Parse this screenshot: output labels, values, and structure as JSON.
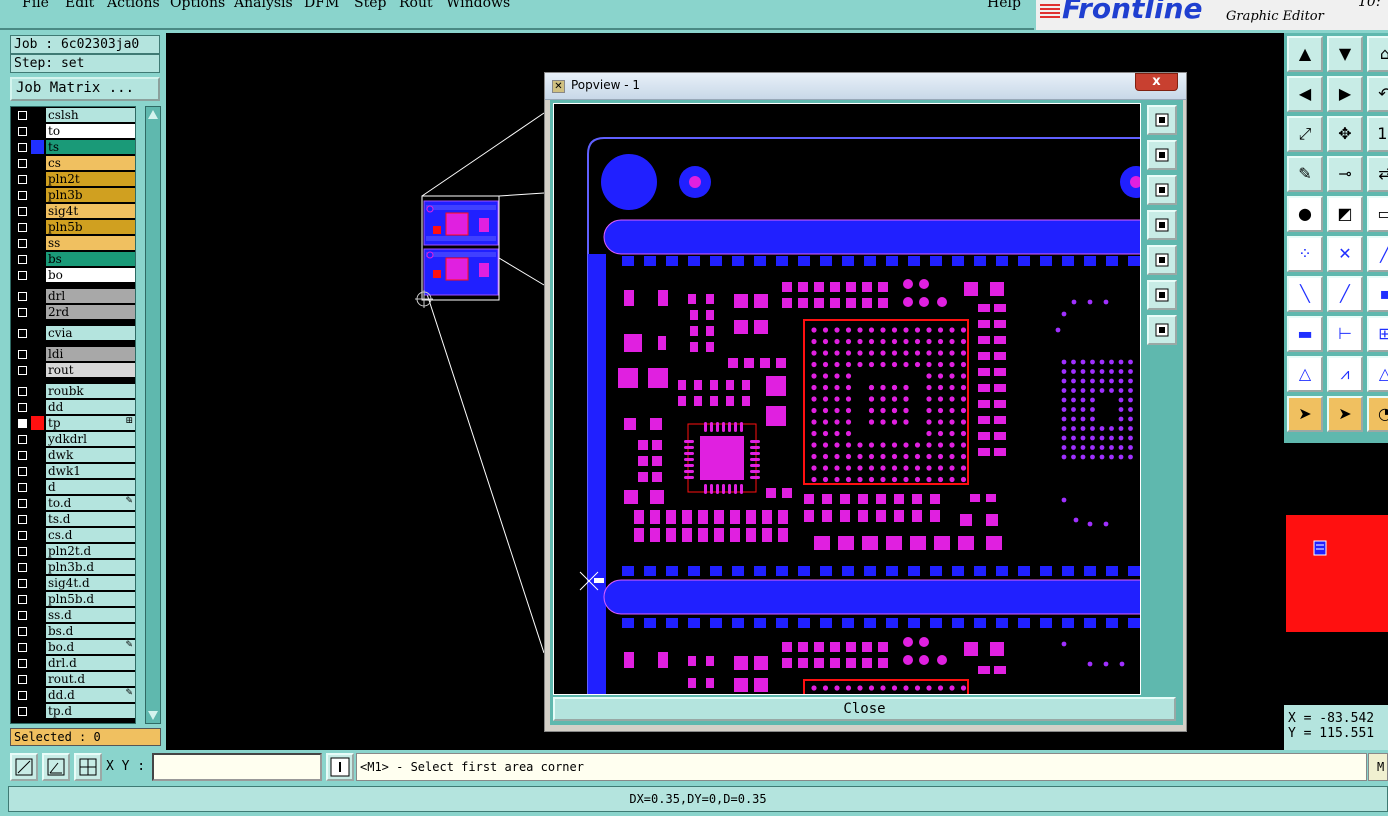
{
  "menu": {
    "items": [
      {
        "label": "File",
        "key": "F"
      },
      {
        "label": "Edit",
        "key": "E"
      },
      {
        "label": "Actions",
        "key": "A"
      },
      {
        "label": "Options",
        "key": "O"
      },
      {
        "label": "Analysis",
        "key": "A"
      },
      {
        "label": "DFM",
        "key": "D"
      },
      {
        "label": "Step",
        "key": "S"
      },
      {
        "label": "Rout",
        "key": "R"
      },
      {
        "label": "Windows",
        "key": "W"
      }
    ],
    "help": "Help"
  },
  "brand": {
    "logo": "Frontline",
    "subtitle": "Graphic Editor",
    "time": "10:"
  },
  "job": {
    "job_label": "Job : 6c02303ja0",
    "step_label": "Step: set",
    "matrix_button": "Job Matrix ..."
  },
  "layers": [
    {
      "name": "cslsh",
      "bg": "#b4e4de",
      "swatch": "#000",
      "group": 1
    },
    {
      "name": "to",
      "bg": "#ffffff",
      "swatch": "#000",
      "group": 1
    },
    {
      "name": "ts",
      "bg": "#1a9a78",
      "swatch": "#2030ff",
      "group": 1
    },
    {
      "name": "cs",
      "bg": "#f0c060",
      "swatch": "#000",
      "group": 1
    },
    {
      "name": "pln2t",
      "bg": "#d0a020",
      "swatch": "#000",
      "group": 1
    },
    {
      "name": "pln3b",
      "bg": "#d0a020",
      "swatch": "#000",
      "group": 1
    },
    {
      "name": "sig4t",
      "bg": "#f0c060",
      "swatch": "#000",
      "group": 1
    },
    {
      "name": "pln5b",
      "bg": "#d0a020",
      "swatch": "#000",
      "group": 1
    },
    {
      "name": "ss",
      "bg": "#f0c060",
      "swatch": "#000",
      "group": 1
    },
    {
      "name": "bs",
      "bg": "#1a9a78",
      "swatch": "#000",
      "group": 1
    },
    {
      "name": "bo",
      "bg": "#ffffff",
      "swatch": "#000",
      "group": 1
    },
    {
      "name": "drl",
      "bg": "#a8a8a8",
      "swatch": "#000",
      "group": 2
    },
    {
      "name": "2rd",
      "bg": "#a8a8a8",
      "swatch": "#000",
      "group": 2
    },
    {
      "name": "cvia",
      "bg": "#b4e4de",
      "swatch": "#000",
      "group": 3
    },
    {
      "name": "ldi",
      "bg": "#a8a8a8",
      "swatch": "#000",
      "group": 4
    },
    {
      "name": "rout",
      "bg": "#d8d8d8",
      "swatch": "#000",
      "group": 4
    },
    {
      "name": "roubk",
      "bg": "#b4e4de",
      "swatch": "#000",
      "group": 5
    },
    {
      "name": "dd",
      "bg": "#b4e4de",
      "swatch": "#000",
      "group": 5
    },
    {
      "name": "tp",
      "bg": "#b4e4de",
      "swatch": "#ff1010",
      "group": 5,
      "mark": "⊞",
      "selected": true
    },
    {
      "name": "ydkdrl",
      "bg": "#b4e4de",
      "swatch": "#000",
      "group": 5
    },
    {
      "name": "dwk",
      "bg": "#b4e4de",
      "swatch": "#000",
      "group": 5
    },
    {
      "name": "dwk1",
      "bg": "#b4e4de",
      "swatch": "#000",
      "group": 5
    },
    {
      "name": "d",
      "bg": "#b4e4de",
      "swatch": "#000",
      "group": 5
    },
    {
      "name": "to.d",
      "bg": "#b4e4de",
      "swatch": "#000",
      "group": 5,
      "mark": "✎"
    },
    {
      "name": "ts.d",
      "bg": "#b4e4de",
      "swatch": "#000",
      "group": 5
    },
    {
      "name": "cs.d",
      "bg": "#b4e4de",
      "swatch": "#000",
      "group": 5
    },
    {
      "name": "pln2t.d",
      "bg": "#b4e4de",
      "swatch": "#000",
      "group": 5
    },
    {
      "name": "pln3b.d",
      "bg": "#b4e4de",
      "swatch": "#000",
      "group": 5
    },
    {
      "name": "sig4t.d",
      "bg": "#b4e4de",
      "swatch": "#000",
      "group": 5
    },
    {
      "name": "pln5b.d",
      "bg": "#b4e4de",
      "swatch": "#000",
      "group": 5
    },
    {
      "name": "ss.d",
      "bg": "#b4e4de",
      "swatch": "#000",
      "group": 5
    },
    {
      "name": "bs.d",
      "bg": "#b4e4de",
      "swatch": "#000",
      "group": 5
    },
    {
      "name": "bo.d",
      "bg": "#b4e4de",
      "swatch": "#000",
      "group": 5,
      "mark": "✎"
    },
    {
      "name": "drl.d",
      "bg": "#b4e4de",
      "swatch": "#000",
      "group": 5
    },
    {
      "name": "rout.d",
      "bg": "#b4e4de",
      "swatch": "#000",
      "group": 5
    },
    {
      "name": "dd.d",
      "bg": "#b4e4de",
      "swatch": "#000",
      "group": 5,
      "mark": "✎"
    },
    {
      "name": "tp.d",
      "bg": "#b4e4de",
      "swatch": "#000",
      "group": 5
    }
  ],
  "selected_label": "Selected : 0",
  "popview": {
    "title": "Popview - 1",
    "close_x": "x",
    "close_button": "Close"
  },
  "coords": {
    "x": "X = -83.542",
    "y": "Y = 115.551"
  },
  "input": {
    "xy_label": "X Y :",
    "xy_value": "",
    "prompt": "<M1> - Select first area corner",
    "corner_label": "M"
  },
  "status": "DX=0.35,DY=0,D=0.35",
  "colors": {
    "canvas_bg": "#000000",
    "pad_magenta": "#e020e0",
    "copper_blue": "#2020ff",
    "highlight_red": "#ff1010",
    "panel_teal": "#8ad4cc"
  },
  "icons": {
    "popview_tools": [
      "zoom-window-icon",
      "pan-up-icon",
      "pan-down-icon",
      "pan-left-icon",
      "pan-right-icon",
      "zoom-fit-icon",
      "zoom-home-icon"
    ],
    "right_tools": [
      "pan-up-icon",
      "pan-down-icon",
      "home-icon",
      "pan-left-icon",
      "pan-right-icon",
      "undo-view-icon",
      "zoom-fit-icon",
      "zoom-center-icon",
      "zoom-one-icon",
      "palette-icon",
      "snap-icon",
      "measure-icon",
      "select-feature-icon",
      "area-select-icon",
      "ruler-icon",
      "node-icon",
      "cross-icon",
      "line-icon",
      "slope-icon",
      "diag-icon",
      "distance-icon",
      "pad-icon",
      "edge-icon",
      "grid-icon",
      "triangle-icon",
      "arrow-triangle-icon",
      "triangle-alt-icon",
      "pointer-icon",
      "pointer-alt-icon",
      "clock-icon"
    ]
  }
}
